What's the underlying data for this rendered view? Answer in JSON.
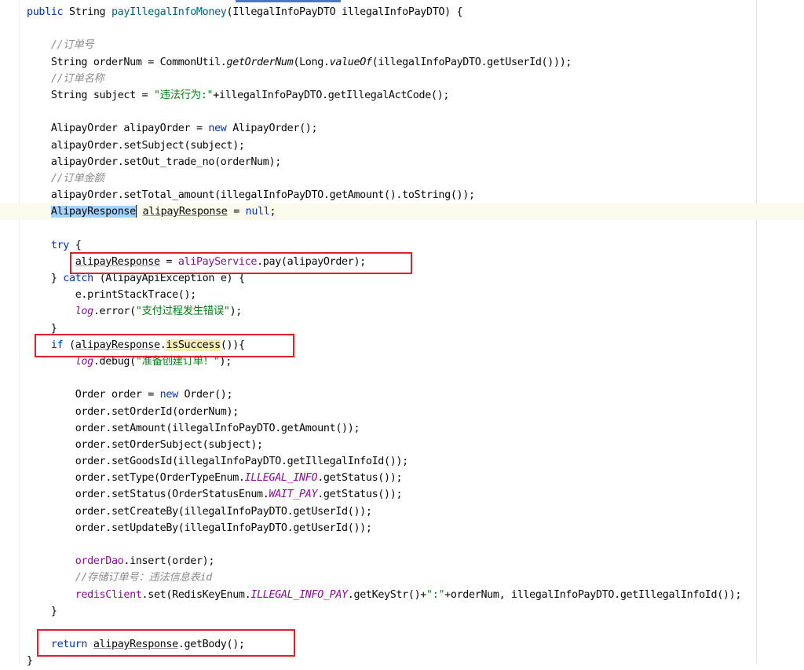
{
  "editor": {
    "language": "java",
    "lines": [
      {
        "indent": 0,
        "tokens": [
          [
            "kw",
            "public "
          ],
          [
            "",
            "String "
          ],
          [
            "kw2",
            "payIllegalInfoMoney"
          ],
          [
            "",
            "(IllegalInfoPayDTO illegalInfoPayDTO) {"
          ]
        ]
      },
      {
        "indent": 0,
        "tokens": []
      },
      {
        "indent": 1,
        "tokens": [
          [
            "cm",
            "//订单号"
          ]
        ]
      },
      {
        "indent": 1,
        "tokens": [
          [
            "",
            "String orderNum = CommonUtil."
          ],
          [
            "it",
            "getOrderNum"
          ],
          [
            "",
            "(Long."
          ],
          [
            "it",
            "valueOf"
          ],
          [
            "",
            "(illegalInfoPayDTO.getUserId()));"
          ]
        ]
      },
      {
        "indent": 1,
        "tokens": [
          [
            "cm",
            "//订单名称"
          ]
        ]
      },
      {
        "indent": 1,
        "tokens": [
          [
            "",
            "String subject = "
          ],
          [
            "str",
            "\"违法行为:\""
          ],
          [
            "",
            "+illegalInfoPayDTO.getIllegalActCode();"
          ]
        ]
      },
      {
        "indent": 0,
        "tokens": []
      },
      {
        "indent": 1,
        "tokens": [
          [
            "",
            "AlipayOrder alipayOrder = "
          ],
          [
            "kw",
            "new "
          ],
          [
            "",
            "AlipayOrder();"
          ]
        ]
      },
      {
        "indent": 1,
        "tokens": [
          [
            "",
            "alipayOrder.setSubject(subject);"
          ]
        ]
      },
      {
        "indent": 1,
        "tokens": [
          [
            "",
            "alipayOrder.setOut_trade_no(orderNum);"
          ]
        ]
      },
      {
        "indent": 1,
        "tokens": [
          [
            "cm",
            "//订单金额"
          ]
        ]
      },
      {
        "indent": 1,
        "tokens": [
          [
            "",
            "alipayOrder.setTotal_amount(illegalInfoPayDTO.getAmount().toString());"
          ]
        ]
      },
      {
        "indent": 1,
        "highlight": true,
        "tokens": [
          [
            "sel",
            "AlipayResponse"
          ],
          [
            "caret",
            ""
          ],
          [
            "",
            ""
          ],
          [
            "sp",
            " "
          ],
          [
            "ul",
            "alipayResponse"
          ],
          [
            "",
            " = "
          ],
          [
            "kw",
            "null"
          ],
          [
            "",
            ";"
          ]
        ]
      },
      {
        "indent": 0,
        "tokens": []
      },
      {
        "indent": 1,
        "tokens": [
          [
            "kw",
            "try "
          ],
          [
            "",
            "{"
          ]
        ]
      },
      {
        "indent": 2,
        "tokens": [
          [
            "ul",
            "alipayResponse"
          ],
          [
            "",
            " = "
          ],
          [
            "pur",
            "aliPayService"
          ],
          [
            "",
            ".pay(alipayOrder);"
          ]
        ]
      },
      {
        "indent": 1,
        "tokens": [
          [
            "",
            "} "
          ],
          [
            "kw",
            "catch "
          ],
          [
            "",
            "(AlipayApiException e) {"
          ]
        ]
      },
      {
        "indent": 2,
        "tokens": [
          [
            "",
            "e.printStackTrace();"
          ]
        ]
      },
      {
        "indent": 2,
        "tokens": [
          [
            "cst",
            "log"
          ],
          [
            "",
            ".error("
          ],
          [
            "str",
            "\"支付过程发生错误\""
          ],
          [
            "",
            ");"
          ]
        ]
      },
      {
        "indent": 1,
        "tokens": [
          [
            "",
            "}"
          ]
        ]
      },
      {
        "indent": 1,
        "tokens": [
          [
            "kw",
            "if "
          ],
          [
            "",
            "("
          ],
          [
            "ul",
            "alipayResponse"
          ],
          [
            "",
            "."
          ],
          [
            "usage",
            "isSuccess"
          ],
          [
            "",
            "()){"
          ]
        ]
      },
      {
        "indent": 2,
        "tokens": [
          [
            "cst",
            "log"
          ],
          [
            "",
            ".debug("
          ],
          [
            "str",
            "\"准备创建订单！\""
          ],
          [
            "",
            ");"
          ]
        ]
      },
      {
        "indent": 0,
        "tokens": []
      },
      {
        "indent": 2,
        "tokens": [
          [
            "",
            "Order order = "
          ],
          [
            "kw",
            "new "
          ],
          [
            "",
            "Order();"
          ]
        ]
      },
      {
        "indent": 2,
        "tokens": [
          [
            "",
            "order.setOrderId(orderNum);"
          ]
        ]
      },
      {
        "indent": 2,
        "tokens": [
          [
            "",
            "order.setAmount(illegalInfoPayDTO.getAmount());"
          ]
        ]
      },
      {
        "indent": 2,
        "tokens": [
          [
            "",
            "order.setOrderSubject(subject);"
          ]
        ]
      },
      {
        "indent": 2,
        "tokens": [
          [
            "",
            "order.setGoodsId(illegalInfoPayDTO.getIllegalInfoId());"
          ]
        ]
      },
      {
        "indent": 2,
        "tokens": [
          [
            "",
            "order.setType(OrderTypeEnum."
          ],
          [
            "cst",
            "ILLEGAL_INFO"
          ],
          [
            "",
            ".getStatus());"
          ]
        ]
      },
      {
        "indent": 2,
        "tokens": [
          [
            "",
            "order.setStatus(OrderStatusEnum."
          ],
          [
            "cst",
            "WAIT_PAY"
          ],
          [
            "",
            ".getStatus());"
          ]
        ]
      },
      {
        "indent": 2,
        "tokens": [
          [
            "",
            "order.setCreateBy(illegalInfoPayDTO.getUserId());"
          ]
        ]
      },
      {
        "indent": 2,
        "tokens": [
          [
            "",
            "order.setUpdateBy(illegalInfoPayDTO.getUserId());"
          ]
        ]
      },
      {
        "indent": 0,
        "tokens": []
      },
      {
        "indent": 2,
        "tokens": [
          [
            "pur",
            "orderDao"
          ],
          [
            "",
            ".insert(order);"
          ]
        ]
      },
      {
        "indent": 2,
        "tokens": [
          [
            "cm",
            "//存储订单号：违法信息表id"
          ]
        ]
      },
      {
        "indent": 2,
        "tokens": [
          [
            "pur",
            "redisClient"
          ],
          [
            "",
            ".set(RedisKeyEnum."
          ],
          [
            "cst",
            "ILLEGAL_INFO_PAY"
          ],
          [
            "",
            ".getKeyStr()+"
          ],
          [
            "str",
            "\":\""
          ],
          [
            "",
            "+orderNum, illegalInfoPayDTO.getIllegalInfoId());"
          ]
        ]
      },
      {
        "indent": 1,
        "tokens": [
          [
            "",
            "}"
          ]
        ]
      },
      {
        "indent": 0,
        "tokens": []
      },
      {
        "indent": 1,
        "tokens": [
          [
            "kw",
            "return "
          ],
          [
            "ul",
            "alipayResponse"
          ],
          [
            "",
            ".getBody();"
          ]
        ]
      },
      {
        "indent": 0,
        "tokens": [
          [
            "",
            "}"
          ]
        ]
      }
    ]
  },
  "colors": {
    "keyword": "#0033b3",
    "comment": "#8c8c8c",
    "string": "#067d17",
    "field": "#871094",
    "annotation_box": "#e0202a",
    "selection": "#a6d2ff"
  }
}
